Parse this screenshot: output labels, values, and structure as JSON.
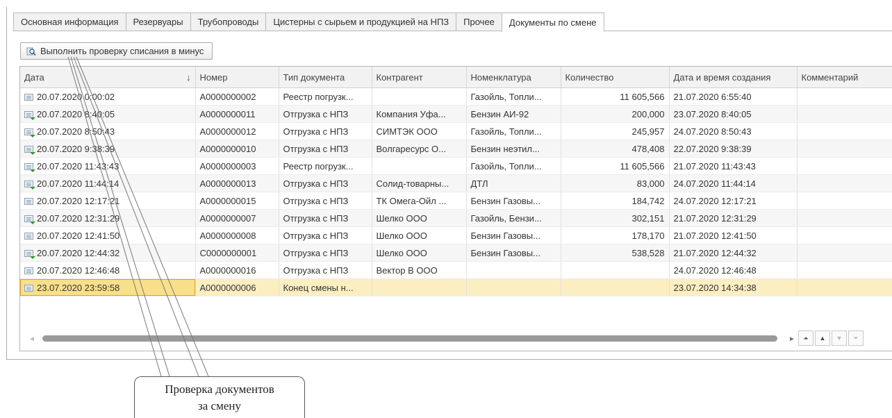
{
  "tabs": [
    {
      "label": "Основная информация",
      "active": false
    },
    {
      "label": "Резервуары",
      "active": false
    },
    {
      "label": "Трубопроводы",
      "active": false
    },
    {
      "label": "Цистерны с сырьем и продукцией на НПЗ",
      "active": false
    },
    {
      "label": "Прочее",
      "active": false
    },
    {
      "label": "Документы по смене",
      "active": true
    }
  ],
  "toolbar": {
    "check_button_label": "Выполнить проверку списания в минус",
    "check_button_icon": "magnifier-icon"
  },
  "grid": {
    "columns": [
      "Дата",
      "Номер",
      "Тип документа",
      "Контрагент",
      "Номенклатура",
      "Количество",
      "Дата и время создания",
      "Комментарий"
    ],
    "sort_indicator": "↓",
    "rows": [
      {
        "posted": false,
        "date": "20.07.2020 0:00:02",
        "number": "А0000000002",
        "type": "Реестр погрузк...",
        "counterparty": "",
        "nomenclature": "Газойль, Топли...",
        "quantity": "11 605,566",
        "created": "21.07.2020 6:55:40",
        "comment": ""
      },
      {
        "posted": true,
        "date": "20.07.2020 8:40:05",
        "number": "А0000000011",
        "type": "Отгрузка с НПЗ",
        "counterparty": "Компания Уфа...",
        "nomenclature": "Бензин АИ-92",
        "quantity": "200,000",
        "created": "23.07.2020 8:40:05",
        "comment": ""
      },
      {
        "posted": true,
        "date": "20.07.2020 8:50:43",
        "number": "А0000000012",
        "type": "Отгрузка с НПЗ",
        "counterparty": "СИМТЭК ООО",
        "nomenclature": "Газойль, Топли...",
        "quantity": "245,957",
        "created": "24.07.2020 8:50:43",
        "comment": ""
      },
      {
        "posted": true,
        "date": "20.07.2020 9:38:39",
        "number": "А0000000010",
        "type": "Отгрузка с НПЗ",
        "counterparty": "Волгаресурс О...",
        "nomenclature": "Бензин неэтил...",
        "quantity": "478,408",
        "created": "22.07.2020 9:38:39",
        "comment": ""
      },
      {
        "posted": true,
        "date": "20.07.2020 11:43:43",
        "number": "А0000000003",
        "type": "Реестр погрузк...",
        "counterparty": "",
        "nomenclature": "Газойль, Топли...",
        "quantity": "11 605,566",
        "created": "21.07.2020 11:43:43",
        "comment": ""
      },
      {
        "posted": true,
        "date": "20.07.2020 11:44:14",
        "number": "А0000000013",
        "type": "Отгрузка с НПЗ",
        "counterparty": "Солид-товарны...",
        "nomenclature": "ДТЛ",
        "quantity": "83,000",
        "created": "24.07.2020 11:44:14",
        "comment": ""
      },
      {
        "posted": false,
        "date": "20.07.2020 12:17:21",
        "number": "А0000000015",
        "type": "Отгрузка с НПЗ",
        "counterparty": "ТК Омега-Ойл ...",
        "nomenclature": "Бензин Газовы...",
        "quantity": "184,742",
        "created": "24.07.2020 12:17:21",
        "comment": ""
      },
      {
        "posted": true,
        "date": "20.07.2020 12:31:29",
        "number": "А0000000007",
        "type": "Отгрузка с НПЗ",
        "counterparty": "Шелко ООО",
        "nomenclature": "Газойль, Бензи...",
        "quantity": "302,151",
        "created": "21.07.2020 12:31:29",
        "comment": ""
      },
      {
        "posted": false,
        "date": "20.07.2020 12:41:50",
        "number": "А0000000008",
        "type": "Отгрузка с НПЗ",
        "counterparty": "Шелко ООО",
        "nomenclature": "Бензин Газовы...",
        "quantity": "178,170",
        "created": "21.07.2020 12:41:50",
        "comment": ""
      },
      {
        "posted": true,
        "date": "20.07.2020 12:44:32",
        "number": "С0000000001",
        "type": "Отгрузка с НПЗ",
        "counterparty": "Шелко ООО",
        "nomenclature": "Бензин Газовы...",
        "quantity": "538,528",
        "created": "21.07.2020 12:44:32",
        "comment": ""
      },
      {
        "posted": false,
        "date": "20.07.2020 12:46:48",
        "number": "А0000000016",
        "type": "Отгрузка с НПЗ",
        "counterparty": "Вектор В ООО",
        "nomenclature": "",
        "quantity": "",
        "created": "24.07.2020 12:46:48",
        "comment": ""
      },
      {
        "posted": false,
        "date": "23.07.2020 23:59:58",
        "number": "А0000000006",
        "type": "Конец смены н...",
        "counterparty": "",
        "nomenclature": "",
        "quantity": "",
        "created": "23.07.2020 14:34:38",
        "comment": "",
        "selected": true
      }
    ]
  },
  "callout": {
    "line1": "Проверка документов",
    "line2": "за смену"
  }
}
